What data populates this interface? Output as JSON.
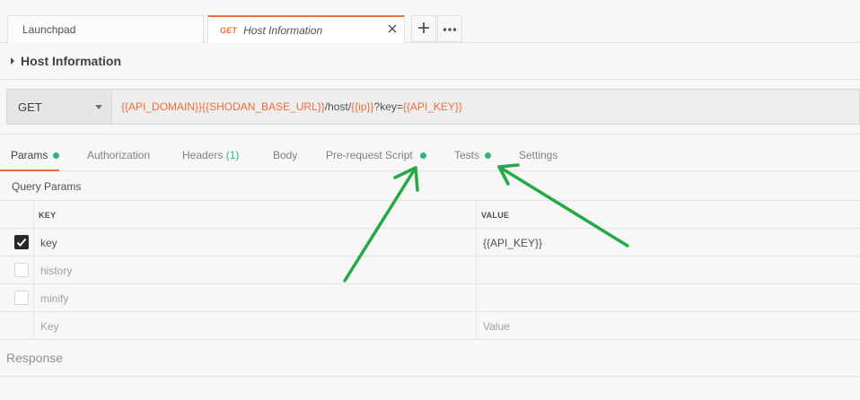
{
  "tabs": {
    "launchpad": "Launchpad",
    "active_method": "GET",
    "active_title": "Host Information"
  },
  "request": {
    "name": "Host Information",
    "method": "GET",
    "url": {
      "api_domain": "{{API_DOMAIN}}",
      "shodan_base_url": "{{SHODAN_BASE_URL}}",
      "path_host": "/host/",
      "ip": "{{ip}}",
      "query_key": "?key=",
      "api_key": "{{API_KEY}}"
    }
  },
  "request_tabs": {
    "params": "Params",
    "authorization": "Authorization",
    "headers": "Headers",
    "headers_count": "(1)",
    "body": "Body",
    "pre_request_script": "Pre-request Script",
    "tests": "Tests",
    "settings": "Settings"
  },
  "query_params": {
    "title": "Query Params",
    "col_key": "KEY",
    "col_value": "VALUE",
    "rows": [
      {
        "key": "key",
        "value": "{{API_KEY}}",
        "checked": true
      },
      {
        "key": "history",
        "value": "",
        "checked": false
      },
      {
        "key": "minify",
        "value": "",
        "checked": false
      }
    ],
    "placeholder_key": "Key",
    "placeholder_value": "Value"
  },
  "response": {
    "title": "Response"
  },
  "colors": {
    "accent": "#f26b3a",
    "status_dot": "#2bb673",
    "annotation_arrow": "#22aa44"
  },
  "icons": [
    "close-icon",
    "plus-icon",
    "more-horizontal-icon",
    "caret-right-icon",
    "chevron-down-icon",
    "checkmark-icon"
  ]
}
